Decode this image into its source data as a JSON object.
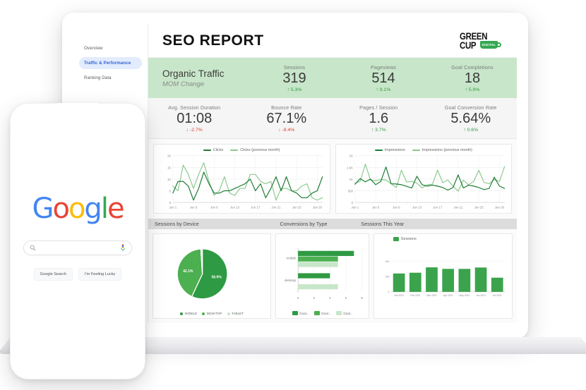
{
  "sidebar": {
    "items": [
      {
        "label": "Overview",
        "active": false
      },
      {
        "label": "Traffic & Performance",
        "active": true
      },
      {
        "label": "Ranking Data",
        "active": false
      }
    ]
  },
  "report": {
    "title": "SEO REPORT",
    "logo": {
      "line1": "GREEN",
      "line2": "CUP",
      "cup_text": "DIGITAL",
      "color": "#35a853"
    },
    "lead": {
      "title": "Organic Traffic",
      "subtitle": "MOM Change"
    },
    "kpis_primary": [
      {
        "label": "Sessions",
        "value": "319",
        "delta": "5.3%",
        "direction": "up",
        "arrow": "↑"
      },
      {
        "label": "Pageviews",
        "value": "514",
        "delta": "9.1%",
        "direction": "up",
        "arrow": "↑"
      },
      {
        "label": "Goal Completions",
        "value": "18",
        "delta": "5.9%",
        "direction": "up",
        "arrow": "↑"
      }
    ],
    "kpis_secondary": [
      {
        "label": "Avg. Session Duration",
        "value": "01:08",
        "delta": "-2.7%",
        "direction": "down",
        "arrow": "↓"
      },
      {
        "label": "Bounce Rate",
        "value": "67.1%",
        "delta": "-8.4%",
        "direction": "down",
        "arrow": "↓"
      },
      {
        "label": "Pages / Session",
        "value": "1.6",
        "delta": "3.7%",
        "direction": "up",
        "arrow": "↑"
      },
      {
        "label": "Goal Conversion Rate",
        "value": "5.64%",
        "delta": "0.6%",
        "direction": "up",
        "arrow": "↑"
      }
    ],
    "section_headers": [
      "Sessions by Device",
      "Conversions by Type",
      "Sessions This Year"
    ]
  },
  "phone": {
    "logo_letters": [
      {
        "ch": "G",
        "cls": "g-b"
      },
      {
        "ch": "o",
        "cls": "g-r"
      },
      {
        "ch": "o",
        "cls": "g-y"
      },
      {
        "ch": "g",
        "cls": "g-b"
      },
      {
        "ch": "l",
        "cls": "g-g"
      },
      {
        "ch": "e",
        "cls": "g-r"
      }
    ],
    "search_placeholder": "",
    "buttons": [
      "Google Search",
      "I'm Feeling Lucky"
    ]
  },
  "colors": {
    "dark_green": "#1e7b34",
    "mid_green": "#4caf50",
    "light_green": "#a5d6a7",
    "pale_green": "#c8e6c9",
    "band_green": "#c8e6c9",
    "up": "#2e9a43",
    "down": "#e23b2e",
    "accent_blue": "#2f62d6"
  },
  "chart_data": [
    {
      "type": "line",
      "title": "Clicks",
      "xlabel": "",
      "ylabel": "",
      "ylim": [
        0,
        20
      ],
      "yticks": [
        0,
        5,
        10,
        15,
        20
      ],
      "ytick_labels": [
        "0",
        "5",
        "10",
        "15",
        "20"
      ],
      "x": [
        "Jun 1",
        "Jun 2",
        "Jun 3",
        "Jun 4",
        "Jun 5",
        "Jun 6",
        "Jun 7",
        "Jun 8",
        "Jun 9",
        "Jun 10",
        "Jun 11",
        "Jun 12",
        "Jun 13",
        "Jun 14",
        "Jun 15",
        "Jun 16",
        "Jun 17",
        "Jun 18",
        "Jun 19",
        "Jun 20",
        "Jun 21",
        "Jun 22",
        "Jun 23",
        "Jun 24",
        "Jun 25",
        "Jun 26",
        "Jun 27",
        "Jun 28",
        "Jun 29",
        "Jun 30"
      ],
      "xtick_labels": [
        "Jun 1",
        "Jun 5",
        "Jun 9",
        "Jun 13",
        "Jun 17",
        "Jun 21",
        "Jun 25",
        "Jun 29"
      ],
      "grid": true,
      "legend_position": "top",
      "series": [
        {
          "name": "Clicks",
          "color": "#1e7b34",
          "values": [
            4,
            9,
            9,
            7,
            1,
            6,
            13,
            8,
            4,
            4,
            5,
            5,
            6,
            7,
            8,
            10,
            5,
            8,
            2,
            6,
            11,
            5,
            11,
            5,
            4,
            2,
            2,
            4,
            5,
            11
          ]
        },
        {
          "name": "Clicks (previous month)",
          "color": "#8bc98f",
          "values": [
            7,
            5,
            16,
            12,
            6,
            12,
            17,
            9,
            3,
            5,
            11,
            4,
            3,
            6,
            6,
            12,
            12,
            9,
            8,
            9,
            1,
            6,
            6,
            5,
            5,
            7,
            8,
            2,
            1,
            2
          ]
        }
      ]
    },
    {
      "type": "line",
      "title": "Impressions",
      "xlabel": "",
      "ylabel": "",
      "ylim": [
        0,
        2000
      ],
      "yticks": [
        0,
        500,
        1000,
        1500,
        2000
      ],
      "ytick_labels": [
        "0",
        "500",
        "1K",
        "1.5K",
        "2K"
      ],
      "x": [
        "Jun 1",
        "Jun 2",
        "Jun 3",
        "Jun 4",
        "Jun 5",
        "Jun 6",
        "Jun 7",
        "Jun 8",
        "Jun 9",
        "Jun 10",
        "Jun 11",
        "Jun 12",
        "Jun 13",
        "Jun 14",
        "Jun 15",
        "Jun 16",
        "Jun 17",
        "Jun 18",
        "Jun 19",
        "Jun 20",
        "Jun 21",
        "Jun 22",
        "Jun 23",
        "Jun 24",
        "Jun 25",
        "Jun 26",
        "Jun 27",
        "Jun 28",
        "Jun 29",
        "Jun 30"
      ],
      "xtick_labels": [
        "Jun 1",
        "Jun 5",
        "Jun 9",
        "Jun 13",
        "Jun 17",
        "Jun 21",
        "Jun 25",
        "Jun 29"
      ],
      "grid": true,
      "legend_position": "top",
      "series": [
        {
          "name": "Impressions",
          "color": "#1e7b34",
          "values": [
            780,
            1020,
            880,
            1000,
            760,
            900,
            1520,
            800,
            790,
            760,
            690,
            620,
            1120,
            760,
            700,
            740,
            700,
            640,
            530,
            640,
            1180,
            620,
            740,
            700,
            640,
            550,
            600,
            1080,
            700,
            600
          ]
        },
        {
          "name": "Impressions (previous month)",
          "color": "#8bc98f",
          "values": [
            830,
            900,
            1640,
            960,
            930,
            980,
            960,
            800,
            640,
            1380,
            880,
            900,
            830,
            620,
            760,
            780,
            1380,
            850,
            960,
            700,
            480,
            960,
            760,
            900,
            1380,
            860,
            800,
            980,
            900,
            1540
          ]
        }
      ]
    },
    {
      "type": "pie",
      "title": "Sessions by Device",
      "legend_position": "bottom",
      "slices": [
        {
          "label": "MOBILE",
          "value": 56.9,
          "display": "56.9%",
          "color": "#2e9a43"
        },
        {
          "label": "DESKTOP",
          "value": 42.1,
          "display": "42.1%",
          "color": "#4caf50"
        },
        {
          "label": "TABLET",
          "value": 1.0,
          "display": "",
          "color": "#c8e6c9"
        }
      ]
    },
    {
      "type": "bar",
      "orientation": "horizontal",
      "title": "Conversions by Type",
      "categories": [
        "mobile",
        "desktop"
      ],
      "xlim": [
        0,
        8
      ],
      "xticks": [
        0,
        2,
        4,
        6,
        8
      ],
      "xtick_labels": [
        "0",
        "2",
        "4",
        "6",
        "8"
      ],
      "grid": true,
      "legend_position": "bottom",
      "series": [
        {
          "name": "Goal...",
          "color": "#2e9a43",
          "values": [
            7,
            4
          ]
        },
        {
          "name": "Goal...",
          "color": "#4caf50",
          "values": [
            5,
            0
          ]
        },
        {
          "name": "Goal...",
          "color": "#c8e6c9",
          "values": [
            5,
            5
          ]
        }
      ]
    },
    {
      "type": "bar",
      "orientation": "vertical",
      "title": "Sessions This Year",
      "categories": [
        "Jan 2021",
        "Feb 2021",
        "Mar 2021",
        "Apr 2021",
        "May 2021",
        "Jun 2021",
        "Jul 2021"
      ],
      "ylim": [
        0,
        400
      ],
      "yticks": [
        0,
        200,
        400
      ],
      "ytick_labels": [
        "0",
        "200",
        "400"
      ],
      "grid": true,
      "legend_position": "top",
      "series": [
        {
          "name": "Sessions",
          "color": "#3aa34c",
          "values": [
            240,
            250,
            320,
            300,
            300,
            318,
            185
          ]
        }
      ]
    }
  ]
}
